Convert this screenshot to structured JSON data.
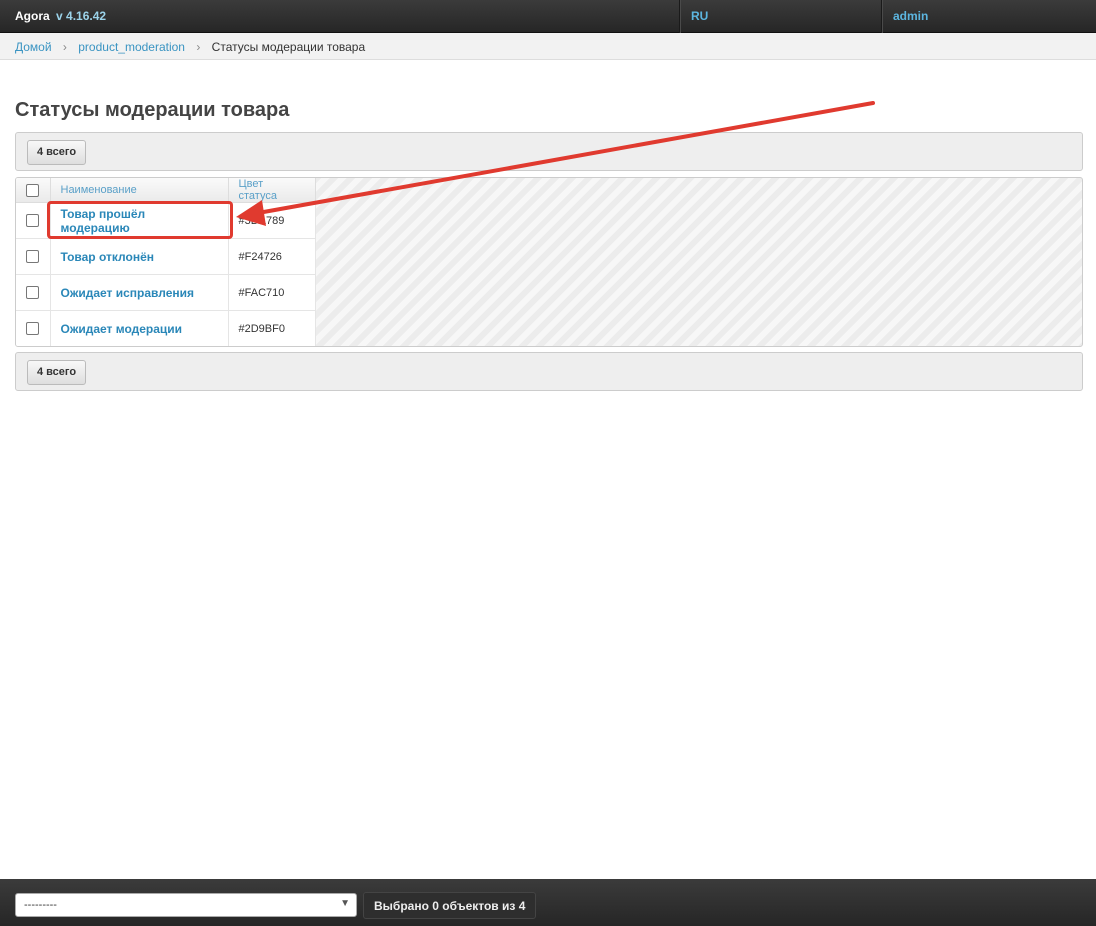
{
  "header": {
    "brand": "Agora",
    "version": "v 4.16.42",
    "language": "RU",
    "user": "admin"
  },
  "breadcrumbs": {
    "home": "Домой",
    "section": "product_moderation",
    "current": "Статусы модерации товара",
    "separator": "›"
  },
  "page": {
    "title": "Статусы модерации товара"
  },
  "paginator": {
    "count_label": "4 всего"
  },
  "table": {
    "columns": [
      "Наименование",
      "Цвет статуса"
    ],
    "rows": [
      {
        "name": "Товар прошёл модерацию",
        "color": "#3DA789"
      },
      {
        "name": "Товар отклонён",
        "color": "#F24726"
      },
      {
        "name": "Ожидает исправления",
        "color": "#FAC710"
      },
      {
        "name": "Ожидает модерации",
        "color": "#2D9BF0"
      }
    ]
  },
  "actions": {
    "select_value": "---------",
    "selected_count": "Выбрано 0 объектов из 4"
  },
  "annotation": {
    "color": "#e03a2f"
  }
}
